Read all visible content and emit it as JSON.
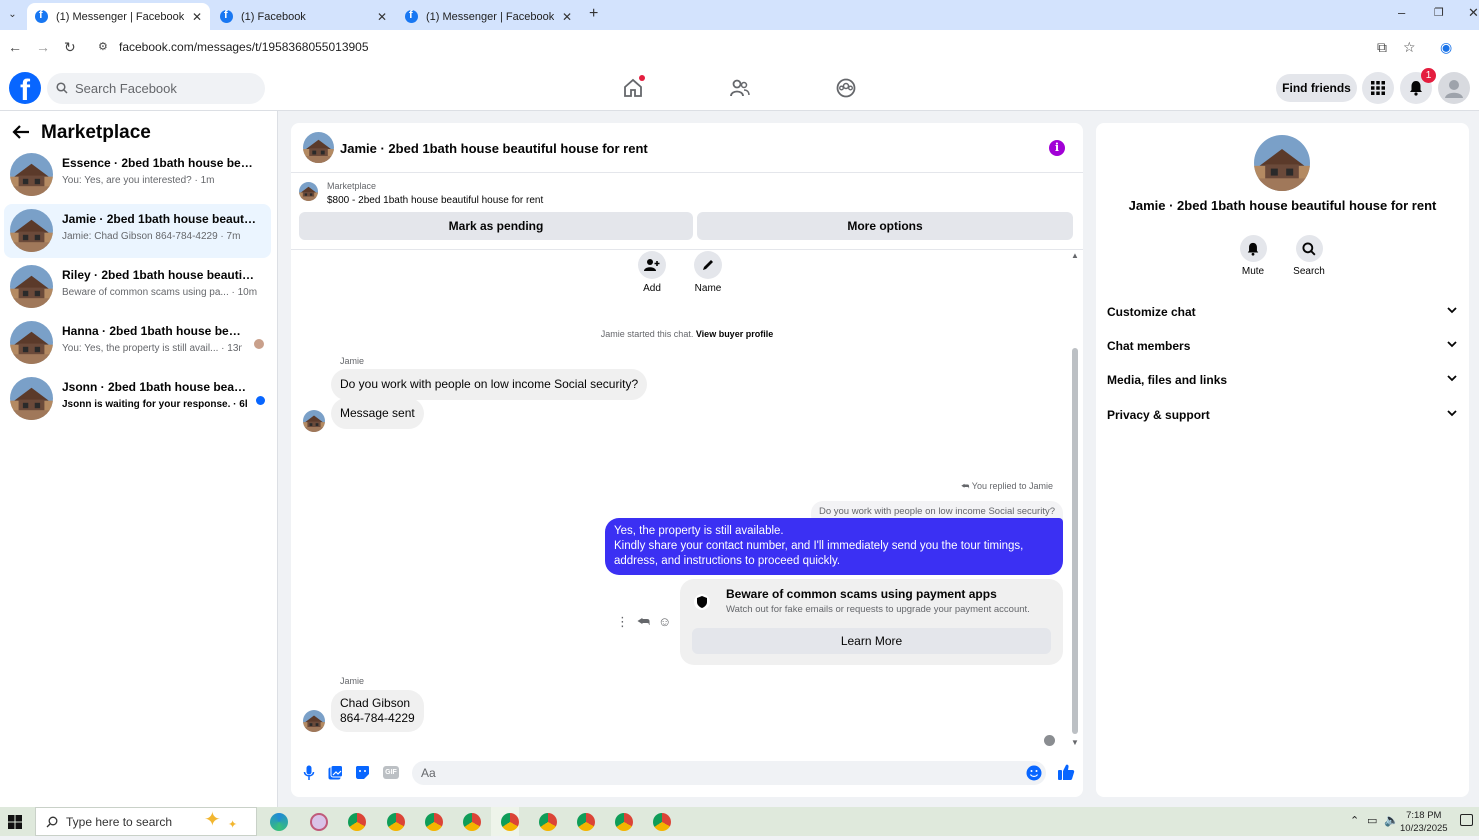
{
  "browser": {
    "tabs": [
      {
        "title": "(1) Messenger | Facebook",
        "active": true
      },
      {
        "title": "(1) Facebook",
        "active": false
      },
      {
        "title": "(1) Messenger | Facebook",
        "active": false
      }
    ],
    "url": "facebook.com/messages/t/1958368055013905"
  },
  "fb_header": {
    "search_placeholder": "Search Facebook",
    "find_friends": "Find friends",
    "notification_count": "1"
  },
  "sidebar": {
    "title": "Marketplace",
    "conversations": [
      {
        "name": "Essence · 2bed 1bath house beautiful house for rent",
        "preview": "You: Yes, are you interested? · 1m",
        "selected": false,
        "unread": false
      },
      {
        "name": "Jamie · 2bed 1bath house beautiful house for rent",
        "preview": "Jamie: Chad Gibson 864-784-4229 · 7m",
        "selected": true,
        "unread": false
      },
      {
        "name": "Riley · 2bed 1bath house beautiful house for rent",
        "preview": "Beware of common scams using pa... · 10m",
        "selected": false,
        "unread": false
      },
      {
        "name": "Hanna · 2bed 1bath house beautiful house for rent",
        "preview": "You: Yes, the property is still avail... · 13m",
        "selected": false,
        "unread": false
      },
      {
        "name": "Jsonn · 2bed 1bath house beautiful house for rent",
        "preview": "Jsonn is waiting for your response. · 6h",
        "selected": false,
        "unread": true
      }
    ]
  },
  "chat": {
    "header_name": "Jamie · 2bed 1bath house beautiful house for rent",
    "listing": {
      "label": "Marketplace",
      "detail": "$800 - 2bed 1bath house beautiful house for rent",
      "mark_pending": "Mark as pending",
      "more_options": "More options"
    },
    "actions": {
      "add": "Add",
      "name": "Name"
    },
    "system_text": "Jamie started this chat.",
    "system_link": "View buyer profile",
    "messages": {
      "sender1": "Jamie",
      "msg1": "Do you work with people on low income Social security?",
      "msg2": "Message sent",
      "replied_label": "You replied to Jamie",
      "quoted": "Do you work with people on low income Social security?",
      "reply_line1": "Yes, the property is still available.",
      "reply_line2": "Kindly share your contact number, and I'll immediately send you the tour timings,",
      "reply_line3": "address, and instructions to proceed quickly.",
      "scam_title": "Beware of common scams using payment apps",
      "scam_sub": "Watch out for fake emails or requests to upgrade your payment account.",
      "learn_more": "Learn More",
      "sender2": "Jamie",
      "msg3_line1": "Chad Gibson",
      "msg3_line2": "864-784-4229"
    },
    "composer_placeholder": "Aa"
  },
  "right_panel": {
    "name": "Jamie · 2bed 1bath house beautiful house for rent",
    "mute": "Mute",
    "search": "Search",
    "sections": [
      "Customize chat",
      "Chat members",
      "Media, files and links",
      "Privacy & support"
    ]
  },
  "taskbar": {
    "search_placeholder": "Type here to search",
    "time": "7:18 PM",
    "date": "10/23/2025"
  },
  "colors": {
    "brand": "#0866ff",
    "my_bubble": "#3b30f3",
    "info_icon": "#a100d6",
    "selected_row": "#ebf5ff"
  }
}
